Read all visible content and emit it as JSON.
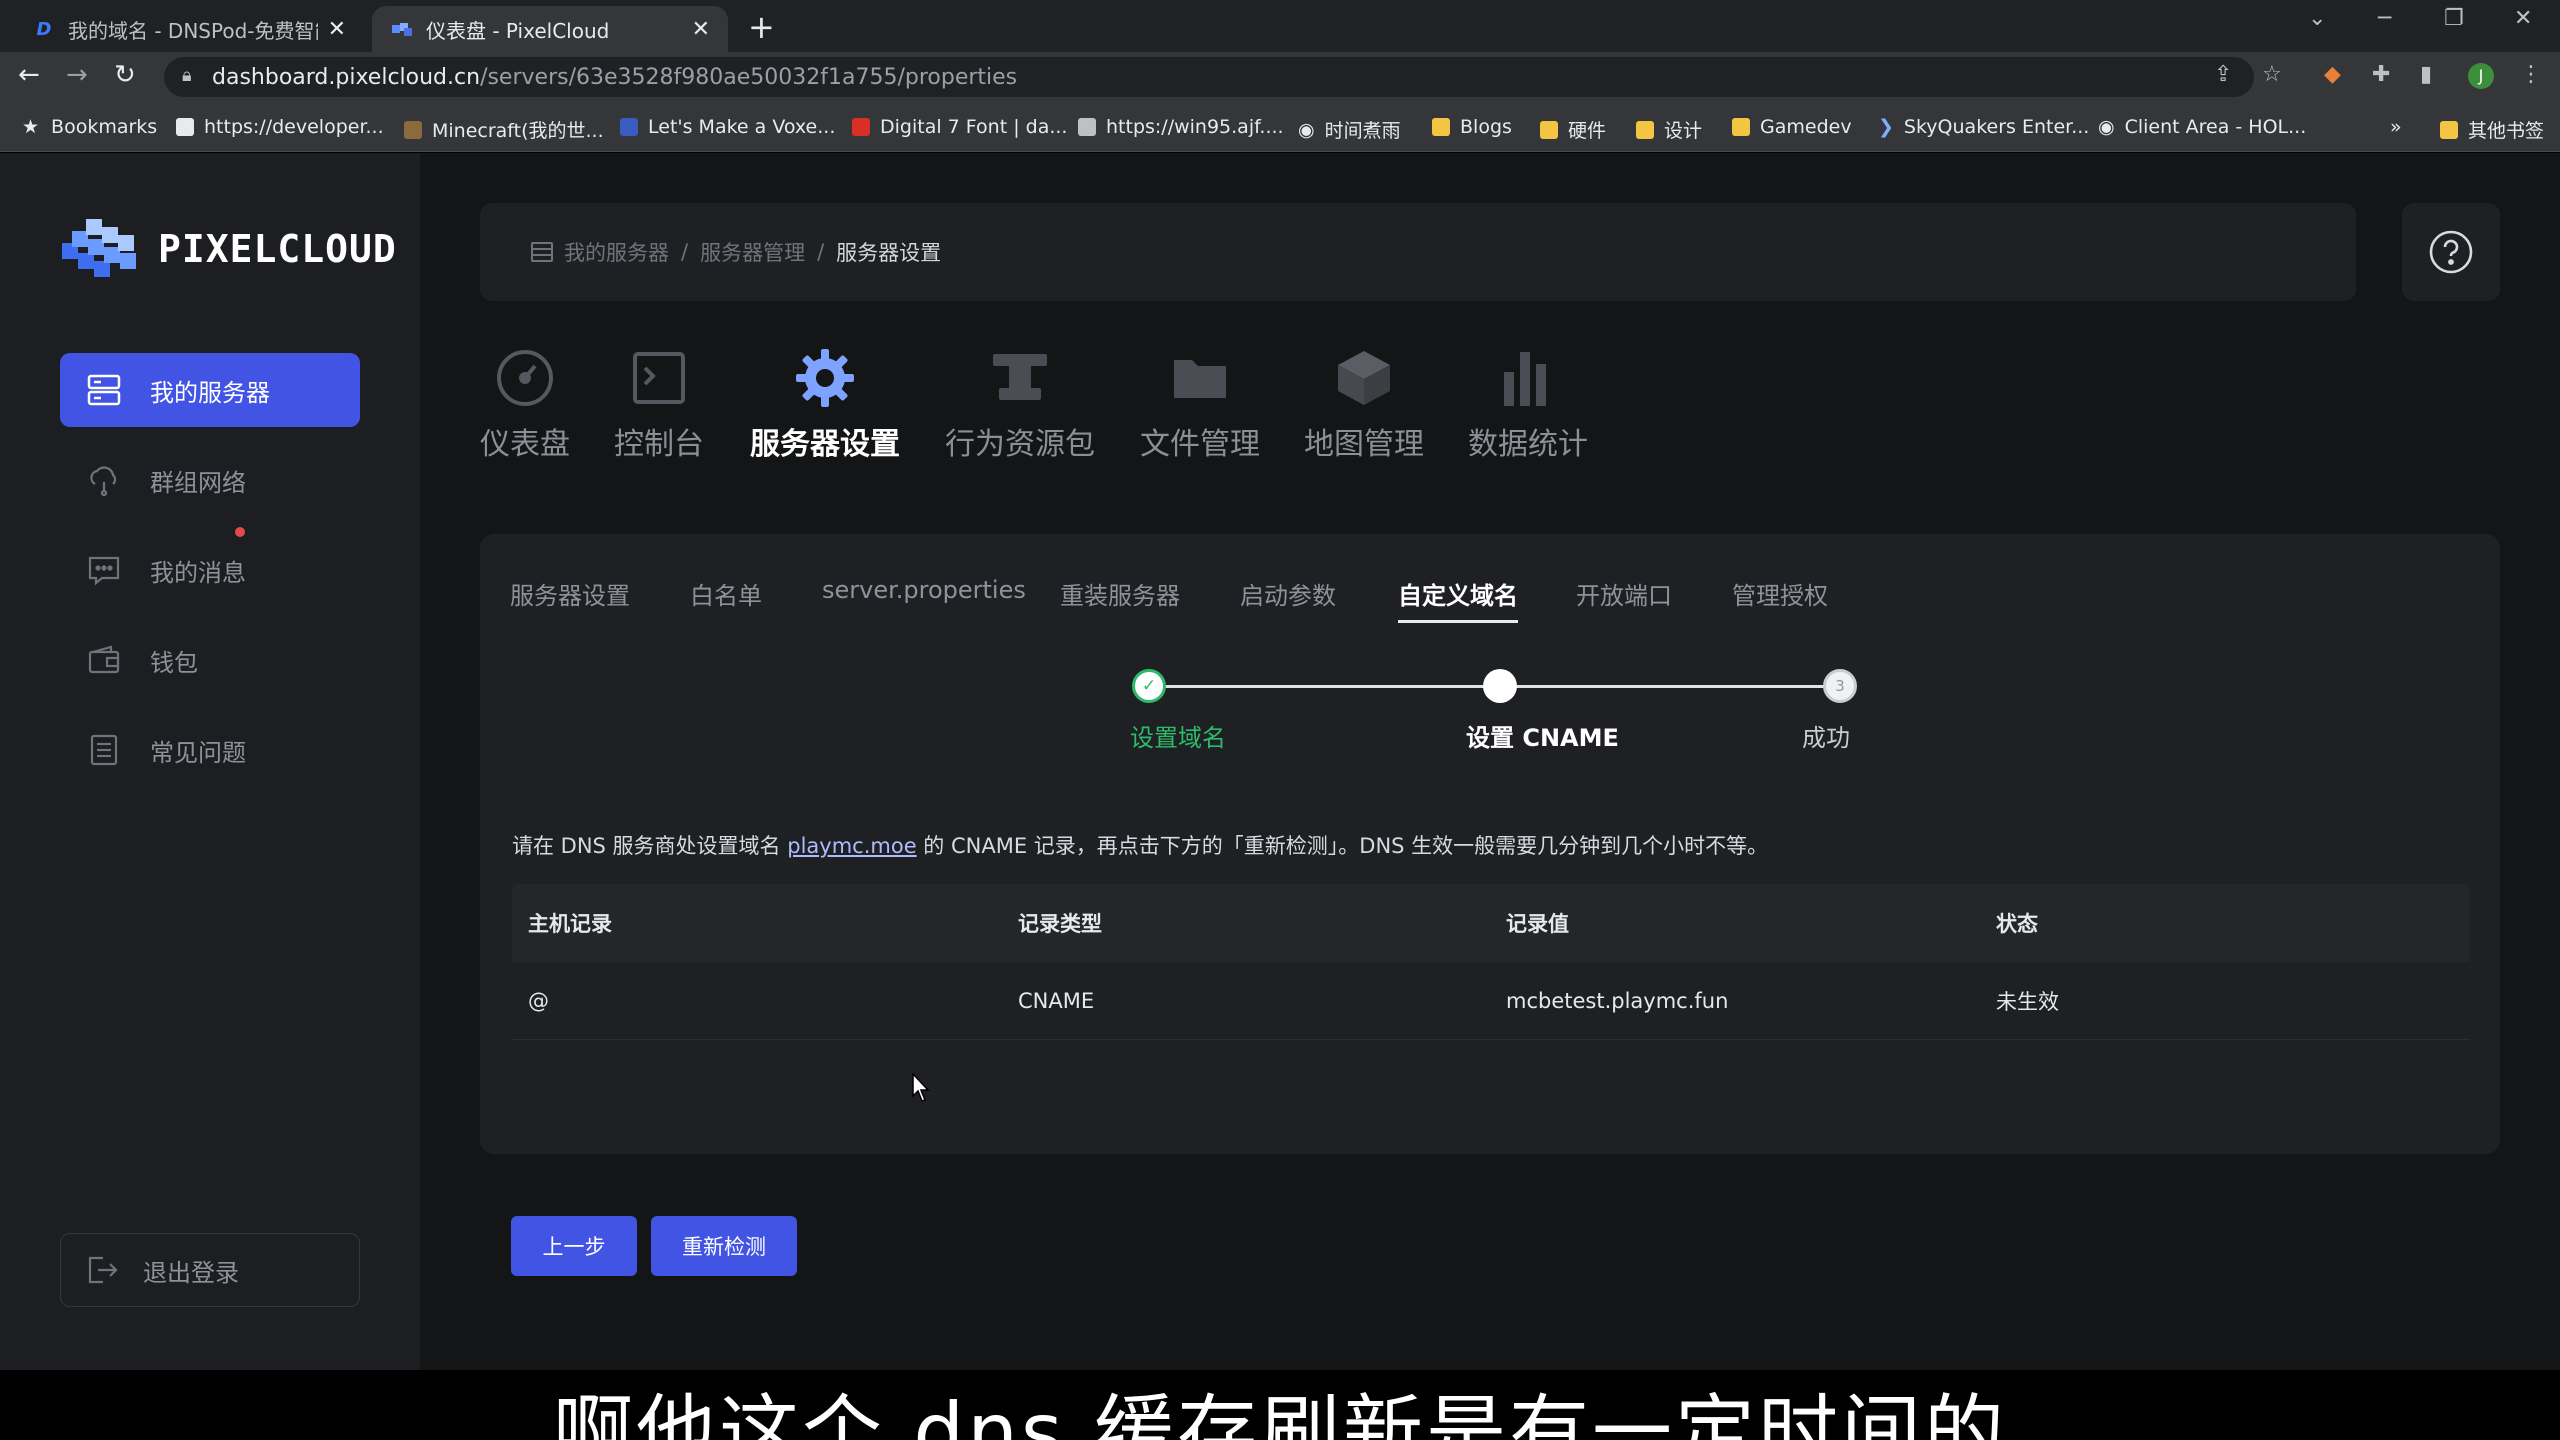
{
  "browser": {
    "tabs": [
      {
        "title": "我的域名 - DNSPod-免费智能DI",
        "icon": "dnspod-d-icon"
      },
      {
        "title": "仪表盘 - PixelCloud",
        "icon": "pixelcloud-icon"
      }
    ],
    "url_host": "dashboard.pixelcloud.cn",
    "url_path": "/servers/63e3528f980ae50032f1a755/properties",
    "avatar_letter": "J",
    "bookmarks": [
      {
        "label": "Bookmarks",
        "icon": "star-icon"
      },
      {
        "label": "https://developer...",
        "icon": "dev-icon"
      },
      {
        "label": "Minecraft(我的世...",
        "icon": "minecraft-icon"
      },
      {
        "label": "Let's Make a Voxe...",
        "icon": "page-icon"
      },
      {
        "label": "Digital 7 Font | da...",
        "icon": "font-icon"
      },
      {
        "label": "https://win95.ajf....",
        "icon": "win95-icon"
      },
      {
        "label": "时间煮雨",
        "icon": "globe-icon"
      },
      {
        "label": "Blogs",
        "icon": "folder-icon"
      },
      {
        "label": "硬件",
        "icon": "folder-icon"
      },
      {
        "label": "设计",
        "icon": "folder-icon"
      },
      {
        "label": "Gamedev",
        "icon": "folder-icon"
      },
      {
        "label": "SkyQuakers Enter...",
        "icon": "page-icon"
      },
      {
        "label": "Client Area - HOL...",
        "icon": "globe-icon"
      }
    ],
    "bookmarks_more": "»",
    "other_bookmarks": "其他书签"
  },
  "app": {
    "logo_text": "PIXELCLOUD",
    "sidebar": [
      {
        "label": "我的服务器",
        "icon": "server-icon",
        "active": true
      },
      {
        "label": "群组网络",
        "icon": "cloud-network-icon",
        "active": false
      },
      {
        "label": "我的消息",
        "icon": "message-icon",
        "active": false
      },
      {
        "label": "钱包",
        "icon": "wallet-icon",
        "active": false
      },
      {
        "label": "常见问题",
        "icon": "faq-icon",
        "active": false
      }
    ],
    "logout": "退出登录",
    "breadcrumb": [
      "我的服务器",
      "服务器管理",
      "服务器设置"
    ],
    "top_nav": [
      {
        "label": "仪表盘",
        "icon": "dashboard-icon"
      },
      {
        "label": "控制台",
        "icon": "console-icon"
      },
      {
        "label": "服务器设置",
        "icon": "settings-gear-icon",
        "active": true
      },
      {
        "label": "行为资源包",
        "icon": "anvil-icon"
      },
      {
        "label": "文件管理",
        "icon": "folder-icon"
      },
      {
        "label": "地图管理",
        "icon": "map-cube-icon"
      },
      {
        "label": "数据统计",
        "icon": "bar-stats-icon"
      }
    ],
    "sub_tabs": [
      "服务器设置",
      "白名单",
      "server.properties",
      "重装服务器",
      "启动参数",
      "自定义域名",
      "开放端口",
      "管理授权"
    ],
    "active_sub_tab": "自定义域名",
    "steps": [
      {
        "label": "设置域名",
        "state": "done"
      },
      {
        "label": "设置 CNAME",
        "state": "current"
      },
      {
        "label": "成功",
        "state": "todo",
        "number": "3"
      }
    ],
    "instruction": {
      "before": "请在 DNS 服务商处设置域名 ",
      "domain": "playmc.moe",
      "after": " 的 CNAME 记录，再点击下方的「重新检测」。DNS 生效一般需要几分钟到几个小时不等。"
    },
    "table": {
      "headers": [
        "主机记录",
        "记录类型",
        "记录值",
        "状态"
      ],
      "rows": [
        [
          "@",
          "CNAME",
          "mcbetest.playmc.fun",
          "未生效"
        ]
      ]
    },
    "buttons": {
      "prev": "上一步",
      "recheck": "重新检测"
    },
    "colors": {
      "accent": "#4154e4",
      "success": "#2dbb6b",
      "link": "#aebcff"
    }
  },
  "subtitle": "啊他这个 dns 缓存刷新是有一定时间的"
}
